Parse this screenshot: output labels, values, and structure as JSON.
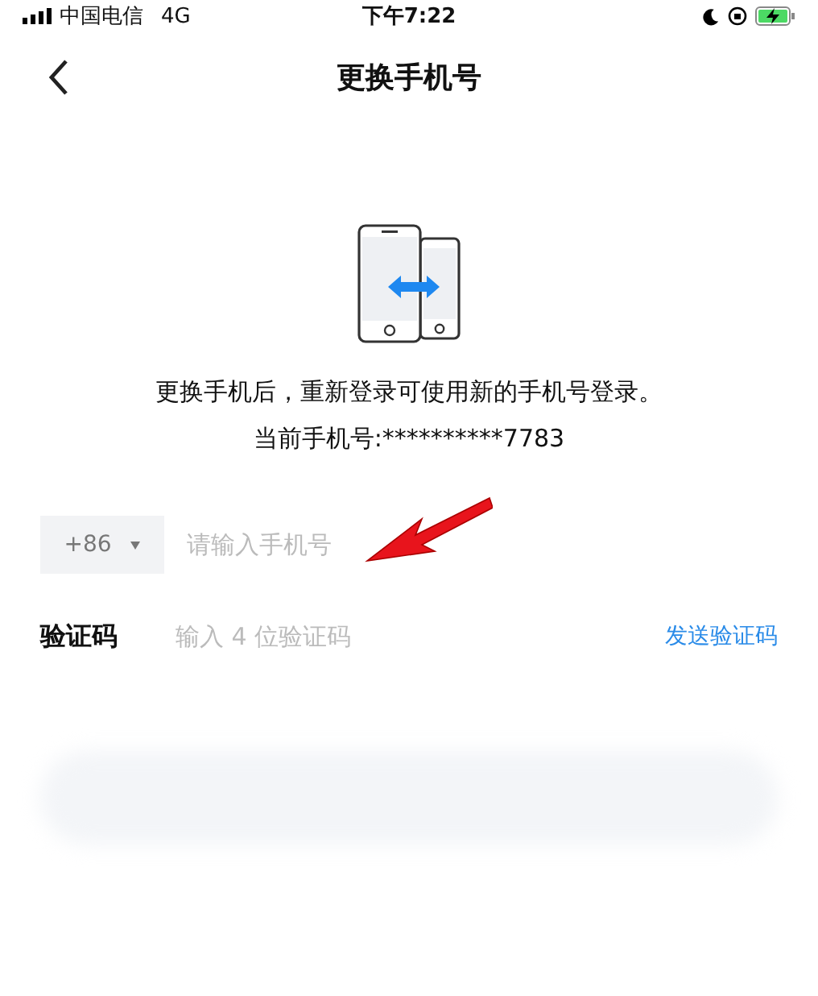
{
  "status_bar": {
    "carrier": "中国电信",
    "network": "4G",
    "time": "下午7:22"
  },
  "nav_bar": {
    "title": "更换手机号"
  },
  "info": {
    "message": "更换手机后，重新登录可使用新的手机号登录。",
    "current_phone": "当前手机号:**********7783"
  },
  "phone_field": {
    "country_code": "+86",
    "placeholder": "请输入手机号"
  },
  "code_field": {
    "label": "验证码",
    "placeholder": "输入 4 位验证码",
    "send_link": "发送验证码"
  }
}
